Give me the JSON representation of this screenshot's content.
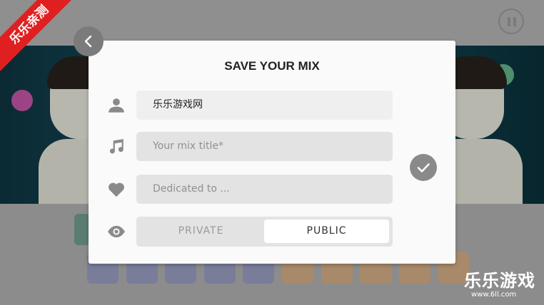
{
  "overlay": {
    "ribbon_text": "乐乐亲测",
    "watermark_title": "乐乐游戏",
    "watermark_url": "www.6ll.com"
  },
  "dialog": {
    "title": "SAVE YOUR MIX",
    "name_value": "乐乐游戏网",
    "mix_title_placeholder": "Your mix title*",
    "dedicated_placeholder": "Dedicated to ...",
    "visibility_options": [
      "PRIVATE",
      "PUBLIC"
    ],
    "visibility_selected": "PUBLIC"
  },
  "icons": {
    "back": "chevron-left-icon",
    "pause": "pause-icon",
    "user": "user-icon",
    "music": "music-note-icon",
    "heart": "heart-icon",
    "eye": "eye-icon",
    "confirm": "checkmark-icon"
  },
  "colors": {
    "dialog_bg": "#fafafa",
    "field_bg": "#e3e3e3",
    "icon_gray": "#8a8a8a",
    "ribbon_red": "#e02020"
  }
}
